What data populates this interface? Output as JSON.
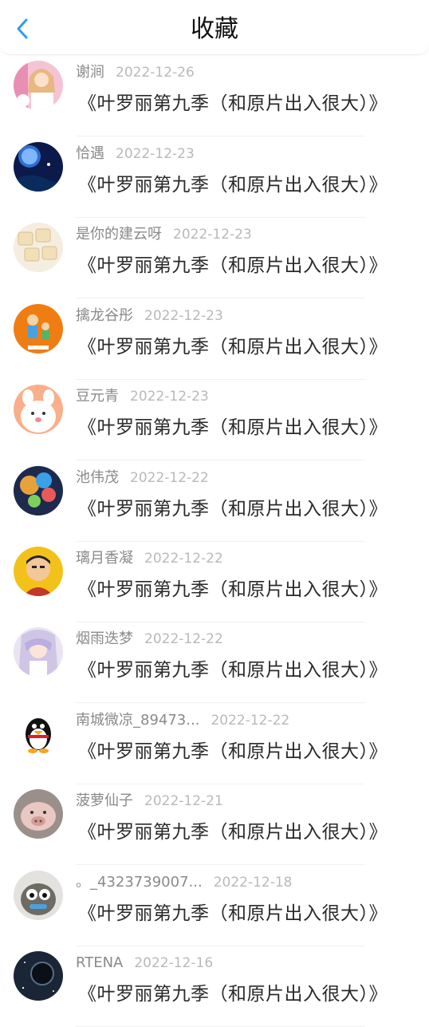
{
  "header": {
    "title": "收藏"
  },
  "favorites": [
    {
      "name": "谢涧",
      "date": "2022-12-26",
      "content": "《叶罗丽第九季（和原片出入很大）》",
      "avatar": "pink-girl-avatar"
    },
    {
      "name": "恰遇",
      "date": "2022-12-23",
      "content": "《叶罗丽第九季（和原片出入很大）》",
      "avatar": "night-moon-avatar"
    },
    {
      "name": "是你的建云呀",
      "date": "2022-12-23",
      "content": "《叶罗丽第九季（和原片出入很大）》",
      "avatar": "mahjong-avatar"
    },
    {
      "name": "擒龙谷彤",
      "date": "2022-12-23",
      "content": "《叶罗丽第九季（和原片出入很大）》",
      "avatar": "cartoon-people-avatar"
    },
    {
      "name": "豆元青",
      "date": "2022-12-23",
      "content": "《叶罗丽第九季（和原片出入很大）》",
      "avatar": "bunny-avatar"
    },
    {
      "name": "池伟茂",
      "date": "2022-12-22",
      "content": "《叶罗丽第九季（和原片出入很大）》",
      "avatar": "balloons-avatar"
    },
    {
      "name": "璃月香凝",
      "date": "2022-12-22",
      "content": "《叶罗丽第九季（和原片出入很大）》",
      "avatar": "cartoon-man-avatar"
    },
    {
      "name": "烟雨迭梦",
      "date": "2022-12-22",
      "content": "《叶罗丽第九季（和原片出入很大）》",
      "avatar": "anime-girl-avatar"
    },
    {
      "name": "南城微凉_89473...",
      "date": "2022-12-22",
      "content": "《叶罗丽第九季（和原片出入很大）》",
      "avatar": "penguin-avatar"
    },
    {
      "name": "菠萝仙子",
      "date": "2022-12-21",
      "content": "《叶罗丽第九季（和原片出入很大）》",
      "avatar": "pig-avatar"
    },
    {
      "name": "。_4323739007...",
      "date": "2022-12-18",
      "content": "《叶罗丽第九季（和原片出入很大）》",
      "avatar": "creature-avatar"
    },
    {
      "name": "RTENA",
      "date": "2022-12-16",
      "content": "《叶罗丽第九季（和原片出入很大）》",
      "avatar": "space-avatar"
    }
  ]
}
